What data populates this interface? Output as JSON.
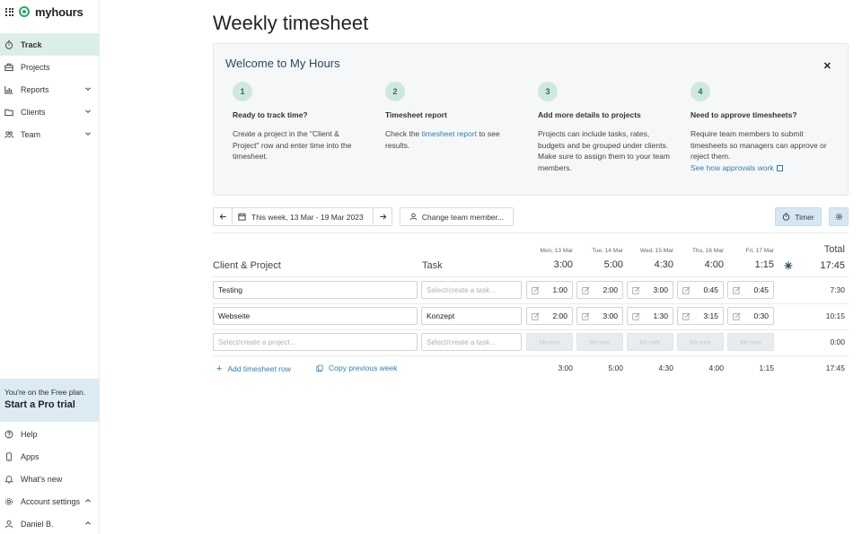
{
  "brand": {
    "name": "myhours"
  },
  "sidebar": {
    "items": [
      {
        "label": "Track",
        "icon": "stopwatch-icon",
        "active": true,
        "chevron": false
      },
      {
        "label": "Projects",
        "icon": "briefcase-icon",
        "chevron": false
      },
      {
        "label": "Reports",
        "icon": "bar-chart-icon",
        "chevron": true
      },
      {
        "label": "Clients",
        "icon": "folder-icon",
        "chevron": true
      },
      {
        "label": "Team",
        "icon": "users-icon",
        "chevron": true
      }
    ],
    "promo": {
      "line1": "You're on the Free plan.",
      "line2": "Start a Pro trial"
    },
    "bottom_items": [
      {
        "label": "Help",
        "icon": "help-circle-icon"
      },
      {
        "label": "Apps",
        "icon": "phone-icon"
      },
      {
        "label": "What's new",
        "icon": "bell-icon"
      },
      {
        "label": "Account settings",
        "icon": "gear-icon",
        "chevron_up": true
      },
      {
        "label": "Daniel B.",
        "icon": "user-icon",
        "chevron_up": true
      }
    ]
  },
  "page": {
    "title": "Weekly timesheet"
  },
  "welcome": {
    "title": "Welcome to My Hours",
    "steps": [
      {
        "num": "1",
        "title": "Ready to track time?",
        "body": "Create a project in the \"Client & Project\" row and enter time into the timesheet."
      },
      {
        "num": "2",
        "title": "Timesheet report",
        "body_pre": "Check the ",
        "link": "timesheet report",
        "body_post": " to see results."
      },
      {
        "num": "3",
        "title": "Add more details to projects",
        "body": "Projects can include tasks, rates, budgets and be grouped under clients. Make sure to assign them to your team members."
      },
      {
        "num": "4",
        "title": "Need to approve timesheets?",
        "body": "Require team members to submit timesheets so managers can approve or reject them.",
        "link": "See how approvals work"
      }
    ]
  },
  "toolbar": {
    "week_label": "This week, 13 Mar - 19 Mar 2023",
    "change_member": "Change team member...",
    "timer": "Timer"
  },
  "table": {
    "col_client": "Client & Project",
    "col_task": "Task",
    "col_total": "Total",
    "days": [
      {
        "label": "Mon, 13 Mar",
        "total": "3:00"
      },
      {
        "label": "Tue, 14 Mar",
        "total": "5:00"
      },
      {
        "label": "Wed, 15 Mar",
        "total": "4:30"
      },
      {
        "label": "Thu, 16 Mar",
        "total": "4:00"
      },
      {
        "label": "Fri, 17 Mar",
        "total": "1:15"
      }
    ],
    "grand_total": "17:45",
    "rows": [
      {
        "project": "Testing",
        "task": "",
        "task_placeholder": "Select/create a task...",
        "cells": [
          "1:00",
          "2:00",
          "3:00",
          "0:45",
          "0:45"
        ],
        "total": "7:30"
      },
      {
        "project": "Webseite",
        "task": "Konzept",
        "cells": [
          "2:00",
          "3:00",
          "1:30",
          "3:15",
          "0:30"
        ],
        "total": "10:15"
      }
    ],
    "empty_row": {
      "project_placeholder": "Select/create a project...",
      "task_placeholder": "Select/create a task...",
      "cell_placeholder": "hh:mm",
      "total": "0:00"
    },
    "footer": {
      "add_row": "Add timesheet row",
      "copy_week": "Copy previous week",
      "totals": [
        "3:00",
        "5:00",
        "4:30",
        "4:00",
        "1:15"
      ],
      "grand_total": "17:45"
    }
  }
}
